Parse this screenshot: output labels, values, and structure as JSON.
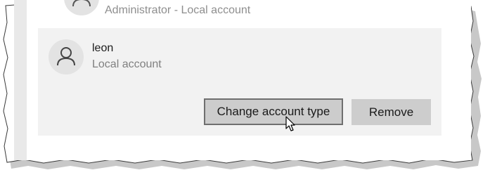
{
  "previous_account": {
    "subtitle": "Administrator - Local account",
    "avatar_icon": "person-icon"
  },
  "account": {
    "name": "leon",
    "type": "Local account",
    "avatar_icon": "person-icon"
  },
  "actions": {
    "change_type_label": "Change account type",
    "remove_label": "Remove"
  },
  "cursor_icon": "mouse-pointer-icon",
  "colors": {
    "card_background": "#f2f2f2",
    "button_background": "#cccccc",
    "focus_border": "#6f6f6f",
    "avatar_background": "#e3e3e3"
  }
}
